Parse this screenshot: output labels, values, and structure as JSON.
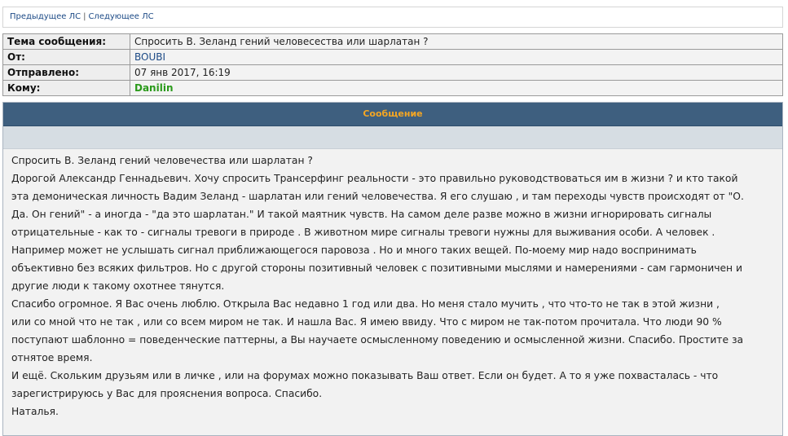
{
  "nav": {
    "prev": "Предыдущее ЛС",
    "separator": "|",
    "next": "Следующее ЛС"
  },
  "info": {
    "subject_label": "Тема сообщения:",
    "subject": "Спросить В. Зеланд гений человесества или шарлатан ?",
    "from_label": "От:",
    "from": "BOUBI",
    "sent_label": "Отправлено:",
    "sent": "07 янв 2017, 16:19",
    "to_label": "Кому:",
    "to": "Danilin"
  },
  "message": {
    "header": "Сообщение",
    "lines": [
      "Спросить В. Зеланд гений человечества или шарлатан ?",
      "Дорогой Александр Геннадьевич. Хочу спросить Трансерфинг реальности - это правильно руководствоваться им в жизни ? и кто такой",
      "эта демоническая личность Вадим Зеланд - шарлатан или гений человечества. Я его слушаю , и там переходы чувств происходят от \"О.",
      "Да. Он гений\" - а иногда - \"да это шарлатан.\" И такой маятник чувств. На самом деле разве можно в жизни игнорировать сигналы",
      "отрицательные - как то - сигналы тревоги в природе . В животном мире сигналы тревоги нужны для выживания особи. А человек .",
      "Например может не услышать сигнал приближающегося паровоза . Но и много таких вещей. По-моему мир надо воспринимать",
      "объективно без всяких фильтров. Но с другой стороны позитивный человек с позитивными мыслями и намерениями - сам гармоничен и",
      "другие люди к такому охотнее тянутся.",
      "Спасибо огромное. Я Вас очень люблю. Открыла Вас недавно 1 год или два. Но меня стало мучить , что что-то не так в этой жизни ,",
      "или со мной что не так , или со всем миром не так. И нашла Вас. Я имею ввиду. Что с миром не так-потом прочитала. Что люди 90 %",
      "поступают шаблонно = поведенческие паттерны, а Вы научаете осмысленному поведению и осмысленной жизни. Спасибо. Простите за",
      "отнятое время.",
      "И ещё. Скольким друзьям или в личке , или на форумах можно показывать Ваш ответ. Если он будет. А то я уже похвасталась - что",
      "зарегистрируюсь у Вас для прояснения вопроса. Спасибо.",
      "Наталья."
    ]
  }
}
